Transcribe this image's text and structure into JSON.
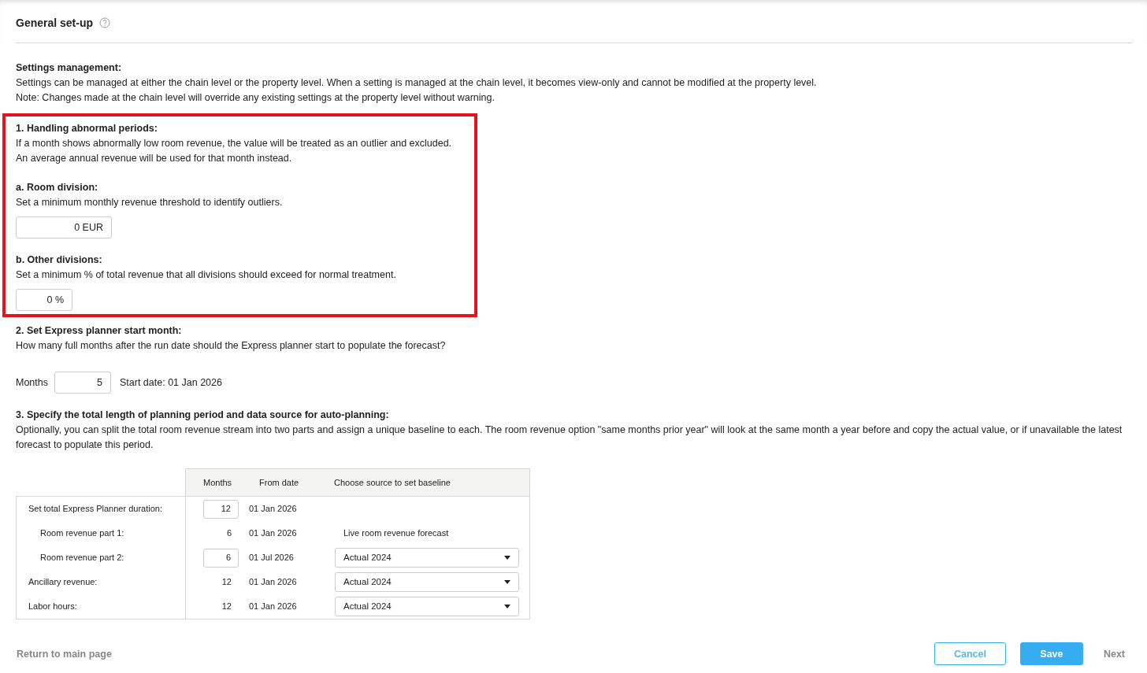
{
  "header": {
    "title": "General set-up"
  },
  "settings_management": {
    "heading": "Settings management:",
    "lines": [
      "Settings can be managed at either the chain level or the property level. When a setting is managed at the chain level, it becomes view-only and cannot be modified at the property level.",
      "Note: Changes made at the chain level will override any existing settings at the property level without warning."
    ]
  },
  "section_1": {
    "highlighted": true,
    "heading": "1.  Handling abnormal periods:",
    "lines": [
      "If a month shows abnormally low room revenue, the value will be treated as an outlier and excluded.",
      "An average annual revenue will be used for that month instead."
    ],
    "subsections": [
      {
        "heading": "a.  Room division:",
        "text": "Set a minimum monthly revenue threshold to identify outliers.",
        "field": {
          "value": "0",
          "unit": "EUR"
        }
      },
      {
        "heading": "b.  Other divisions:",
        "text": "Set a minimum % of total revenue that all divisions should exceed for normal treatment.",
        "field": {
          "value": "0",
          "unit": "%"
        }
      }
    ]
  },
  "section_2": {
    "heading": "2.  Set Express planner start month:",
    "text": "How many full months after the run date should the Express planner start to populate the forecast?",
    "months_label": "Months",
    "months_value": "5",
    "start_date": "Start date: 01 Jan 2026"
  },
  "section_3": {
    "heading": "3.  Specify the total length of planning period and data source for auto-planning:",
    "text": "Optionally, you can split the total room revenue stream into two parts and assign a unique baseline to each. The room revenue option \"same months prior year\" will look at the same month a year before and copy the actual value, or if unavailable the latest forecast to populate this period.",
    "table": {
      "columns": [
        "Months",
        "From date",
        "Choose source to set baseline"
      ],
      "rows": [
        {
          "label": "Set total Express Planner duration:",
          "months": {
            "kind": "input",
            "value": "12"
          },
          "from_date": "01 Jan 2026",
          "children": [
            {
              "label": "Room revenue part 1:",
              "months": {
                "kind": "text",
                "value": "6"
              },
              "from_date": "01 Jan 2026",
              "source": {
                "kind": "text",
                "value": "Live room revenue forecast"
              }
            },
            {
              "label": "Room revenue part 2:",
              "months": {
                "kind": "input",
                "value": "6"
              },
              "from_date": "01 Jul 2026",
              "source": {
                "kind": "select",
                "value": "Actual 2024"
              }
            }
          ]
        },
        {
          "label": "Ancillary revenue:",
          "months": {
            "kind": "text",
            "value": "12"
          },
          "from_date": "01 Jan 2026",
          "source": {
            "kind": "select",
            "value": "Actual 2024"
          }
        },
        {
          "label": "Labor hours:",
          "months": {
            "kind": "text",
            "value": "12"
          },
          "from_date": "01 Jan 2026",
          "source": {
            "kind": "select",
            "value": "Actual 2024"
          }
        }
      ]
    }
  },
  "footer": {
    "back_link": "Return to main page",
    "buttons": [
      "Cancel",
      "Save",
      "Next"
    ]
  }
}
